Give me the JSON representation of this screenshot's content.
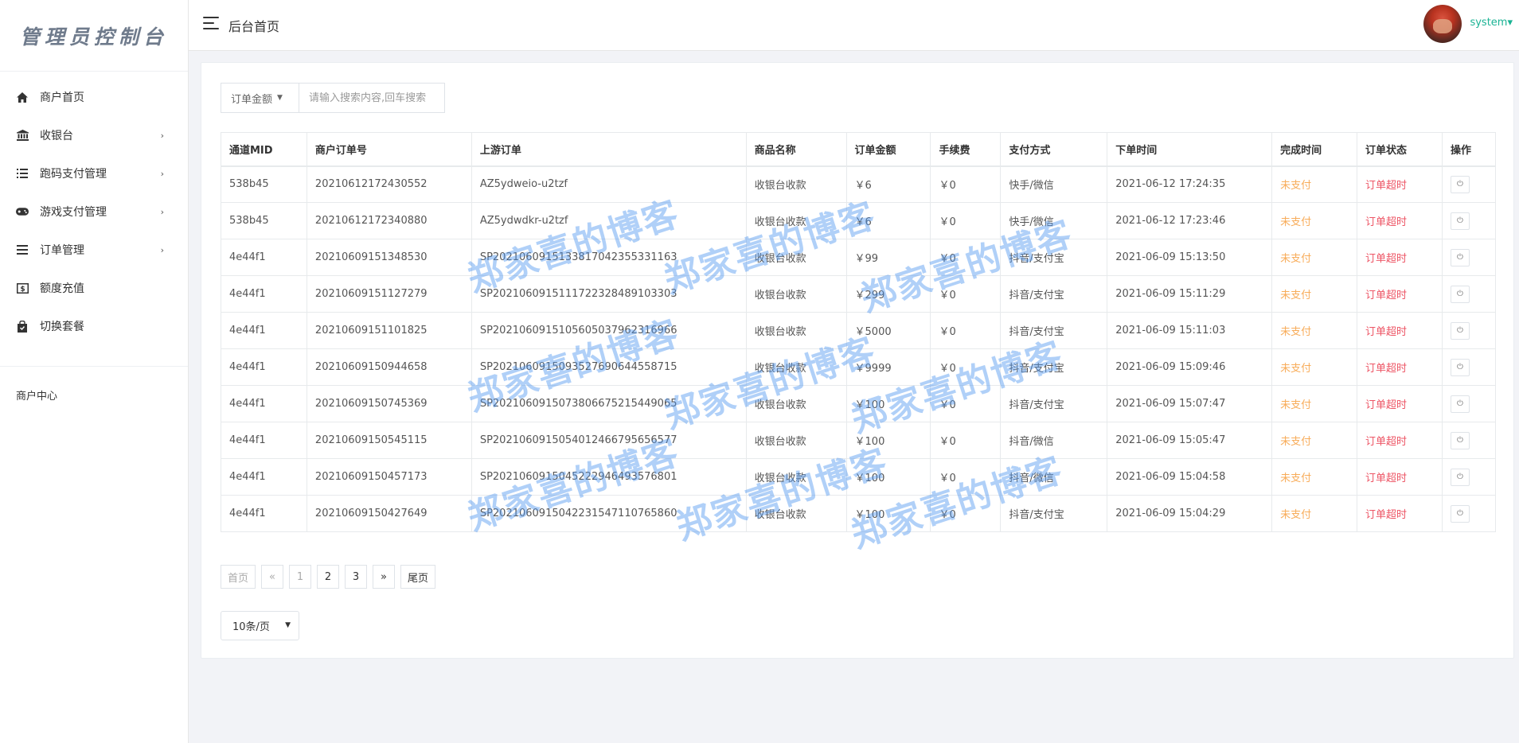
{
  "sidebar": {
    "logo": "管理员控制台",
    "items": [
      {
        "label": "商户首页",
        "icon": "home-icon",
        "chevron": ""
      },
      {
        "label": "收银台",
        "icon": "bank-icon",
        "chevron": "›"
      },
      {
        "label": "跑码支付管理",
        "icon": "list-icon",
        "chevron": "›"
      },
      {
        "label": "游戏支付管理",
        "icon": "gamepad-icon",
        "chevron": "›"
      },
      {
        "label": "订单管理",
        "icon": "menu-icon",
        "chevron": "›"
      },
      {
        "label": "额度充值",
        "icon": "money-icon",
        "chevron": ""
      },
      {
        "label": "切换套餐",
        "icon": "bag-icon",
        "chevron": ""
      }
    ],
    "section_label": "商户中心"
  },
  "header": {
    "title": "后台首页",
    "user": "system▾"
  },
  "search": {
    "field_label": "订单金额",
    "placeholder": "请输入搜索内容,回车搜索"
  },
  "table": {
    "headers": [
      "通道MID",
      "商户订单号",
      "上游订单",
      "商品名称",
      "订单金额",
      "手续费",
      "支付方式",
      "下单时间",
      "完成时间",
      "订单状态",
      "操作"
    ],
    "rows": [
      [
        "538b45",
        "20210612172430552",
        "AZ5ydweio-u2tzf",
        "收银台收款",
        "￥6",
        "￥0",
        "快手/微信",
        "2021-06-12 17:24:35",
        "未支付",
        "订单超时"
      ],
      [
        "538b45",
        "20210612172340880",
        "AZ5ydwdkr-u2tzf",
        "收银台收款",
        "￥6",
        "￥0",
        "快手/微信",
        "2021-06-12 17:23:46",
        "未支付",
        "订单超时"
      ],
      [
        "4e44f1",
        "20210609151348530",
        "SP202106091513381704235533​1163",
        "收银台收款",
        "￥99",
        "￥0",
        "抖音/支付宝",
        "2021-06-09 15:13:50",
        "未支付",
        "订单超时"
      ],
      [
        "4e44f1",
        "20210609151127279",
        "SP20210609151117223284891033​03",
        "收银台收款",
        "￥299",
        "￥0",
        "抖音/支付宝",
        "2021-06-09 15:11:29",
        "未支付",
        "订单超时"
      ],
      [
        "4e44f1",
        "20210609151101825",
        "SP20210609151056050379623169​66",
        "收银台收款",
        "￥5000",
        "￥0",
        "抖音/支付宝",
        "2021-06-09 15:11:03",
        "未支付",
        "订单超时"
      ],
      [
        "4e44f1",
        "20210609150944658",
        "SP20210609150935276906445587​15",
        "收银台收款",
        "￥9999",
        "￥0",
        "抖音/支付宝",
        "2021-06-09 15:09:46",
        "未支付",
        "订单超时"
      ],
      [
        "4e44f1",
        "20210609150745369",
        "SP20210609150738066752154490​65",
        "收银台收款",
        "￥100",
        "￥0",
        "抖音/支付宝",
        "2021-06-09 15:07:47",
        "未支付",
        "订单超时"
      ],
      [
        "4e44f1",
        "20210609150545115",
        "SP20210609150540124667956565​77",
        "收银台收款",
        "￥100",
        "￥0",
        "抖音/微信",
        "2021-06-09 15:05:47",
        "未支付",
        "订单超时"
      ],
      [
        "4e44f1",
        "20210609150457173",
        "SP20210609150452229464935768​01",
        "收银台收款",
        "￥100",
        "￥0",
        "抖音/微信",
        "2021-06-09 15:04:58",
        "未支付",
        "订单超时"
      ],
      [
        "4e44f1",
        "20210609150427649",
        "SP20210609150422315471107658​60",
        "收银台收款",
        "￥100",
        "￥0",
        "抖音/支付宝",
        "2021-06-09 15:04:29",
        "未支付",
        "订单超时"
      ]
    ]
  },
  "pager": {
    "first": "首页",
    "prev": "«",
    "pages": [
      "1",
      "2",
      "3"
    ],
    "next": "»",
    "last": "尾页"
  },
  "page_size": "10条/页",
  "watermark": "郑家喜的博客",
  "colors": {
    "accent": "#1ab394",
    "warning": "#f8ac59",
    "danger": "#ed5565"
  }
}
